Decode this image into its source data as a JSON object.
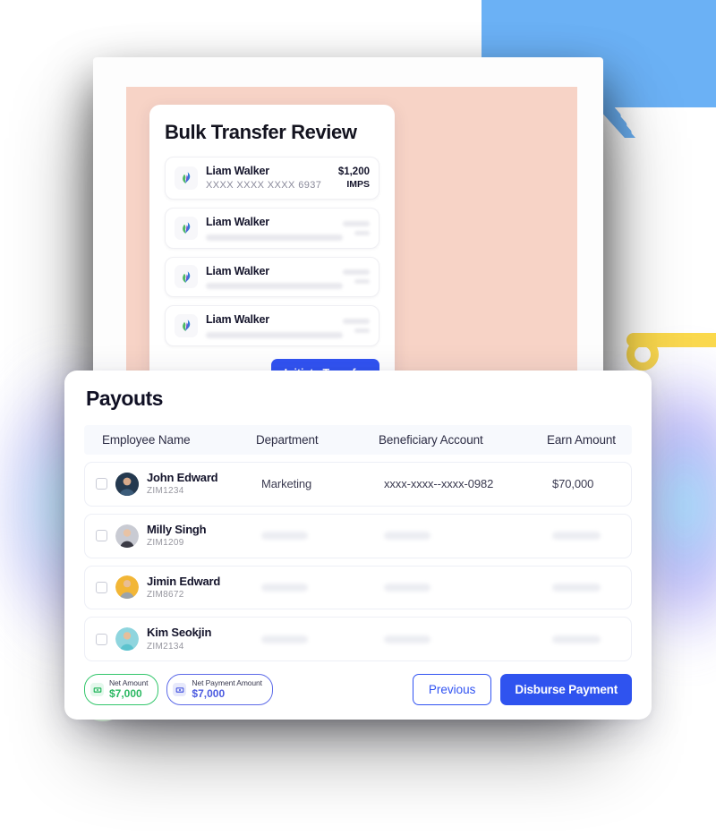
{
  "bulk_transfer": {
    "title": "Bulk Transfer Review",
    "logo_icon": "leaf-logo-icon",
    "rows": [
      {
        "name": "Liam Walker",
        "account": "XXXX XXXX XXXX 6937",
        "amount": "$1,200",
        "mode": "IMPS",
        "redacted": false
      },
      {
        "name": "Liam Walker",
        "account": "",
        "amount": "",
        "mode": "",
        "redacted": true
      },
      {
        "name": "Liam Walker",
        "account": "",
        "amount": "",
        "mode": "",
        "redacted": true
      },
      {
        "name": "Liam Walker",
        "account": "",
        "amount": "",
        "mode": "",
        "redacted": true
      }
    ],
    "initiate_label": "Initiate Transfer"
  },
  "payouts": {
    "title": "Payouts",
    "columns": [
      "Employee Name",
      "Department",
      "Beneficiary Account",
      "Earn Amount"
    ],
    "rows": [
      {
        "name": "John Edward",
        "id": "ZIM1234",
        "department": "Marketing",
        "account": "xxxx-xxxx--xxxx-0982",
        "amount": "$70,000",
        "redacted": false,
        "avatar": "#2A3F57"
      },
      {
        "name": "Milly Singh",
        "id": "ZIM1209",
        "department": "",
        "account": "",
        "amount": "",
        "redacted": true,
        "avatar": "#B9BCC6"
      },
      {
        "name": "Jimin Edward",
        "id": "ZIM8672",
        "department": "",
        "account": "",
        "amount": "",
        "redacted": true,
        "avatar": "#F2B636"
      },
      {
        "name": "Kim Seokjin",
        "id": "ZIM2134",
        "department": "",
        "account": "",
        "amount": "",
        "redacted": true,
        "avatar": "#5BB6C4"
      }
    ],
    "net_amount": {
      "label": "Net Amount",
      "value": "$7,000",
      "icon": "money-card-icon"
    },
    "net_payment_amount": {
      "label": "Net Payment Amount",
      "value": "$7,000",
      "icon": "banknote-icon"
    },
    "previous_label": "Previous",
    "disburse_label": "Disburse Payment"
  },
  "colors": {
    "primary_blue": "#3153F2",
    "panel_pink": "#F7D3C6",
    "accent_blue": "#6BB1F5",
    "accent_yellow": "#FCD94B",
    "accent_green": "#CDE8CB",
    "chip_green": "#33C66B",
    "chip_blue": "#5C6AE8"
  }
}
